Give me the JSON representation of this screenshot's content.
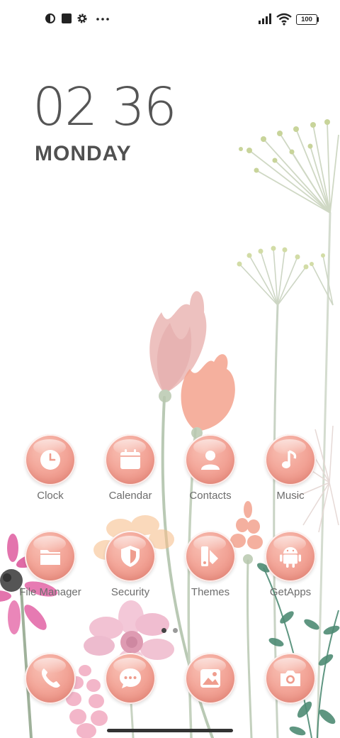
{
  "status_bar": {
    "battery": "100",
    "left_icons": [
      "data-saver-icon",
      "square-notification-icon",
      "settings-gear-icon",
      "more-dots-icon"
    ],
    "right_icons": [
      "signal-icon",
      "wifi-icon",
      "battery-icon"
    ]
  },
  "lock_clock": {
    "time": "02 36",
    "day": "MONDAY"
  },
  "apps": {
    "row1": [
      {
        "label": "Clock",
        "icon": "clock-icon"
      },
      {
        "label": "Calendar",
        "icon": "calendar-icon"
      },
      {
        "label": "Contacts",
        "icon": "person-icon"
      },
      {
        "label": "Music",
        "icon": "music-note-icon"
      }
    ],
    "row2": [
      {
        "label": "File Manager",
        "icon": "folder-icon"
      },
      {
        "label": "Security",
        "icon": "shield-icon"
      },
      {
        "label": "Themes",
        "icon": "themes-icon"
      },
      {
        "label": "GetApps",
        "icon": "android-icon"
      }
    ],
    "dock": [
      {
        "icon": "phone-icon"
      },
      {
        "icon": "chat-bubble-icon"
      },
      {
        "icon": "gallery-icon"
      },
      {
        "icon": "camera-icon"
      }
    ]
  },
  "page_indicator": {
    "pages": 2,
    "current": 1
  },
  "colors": {
    "icon_bubble": "#f3a699",
    "icon_glyph": "#ffffff",
    "label": "#6d6d6d"
  }
}
